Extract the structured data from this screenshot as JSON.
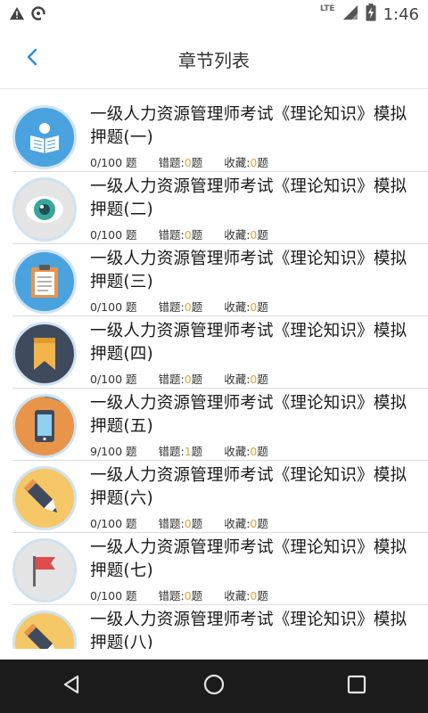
{
  "status_bar": {
    "time": "1:46",
    "network_label": "LTE",
    "icons": [
      "warning-icon",
      "data-saver-icon",
      "signal-icon",
      "battery-icon"
    ]
  },
  "header": {
    "title": "章节列表",
    "back_icon": "chevron-left-icon"
  },
  "labels": {
    "wrong_prefix": "错题:",
    "fav_prefix": "收藏:",
    "fav_suffix": "题",
    "wrong_suffix": "题"
  },
  "chapters": [
    {
      "title": "一级人力资源管理师考试《理论知识》模拟押题(一)",
      "progress": "0/100 题",
      "wrong": "0",
      "favorites": "0",
      "icon": "reading-person-icon"
    },
    {
      "title": "一级人力资源管理师考试《理论知识》模拟押题(二)",
      "progress": "0/100 题",
      "wrong": "0",
      "favorites": "0",
      "icon": "eye-icon"
    },
    {
      "title": "一级人力资源管理师考试《理论知识》模拟押题(三)",
      "progress": "0/100 题",
      "wrong": "0",
      "favorites": "0",
      "icon": "clipboard-icon"
    },
    {
      "title": "一级人力资源管理师考试《理论知识》模拟押题(四)",
      "progress": "0/100 题",
      "wrong": "0",
      "favorites": "0",
      "icon": "bookmark-icon"
    },
    {
      "title": "一级人力资源管理师考试《理论知识》模拟押题(五)",
      "progress": "9/100 题",
      "wrong": "1",
      "favorites": "0",
      "icon": "tablet-icon",
      "progress_fraction": 0.09
    },
    {
      "title": "一级人力资源管理师考试《理论知识》模拟押题(六)",
      "progress": "0/100 题",
      "wrong": "0",
      "favorites": "0",
      "icon": "pencil-icon"
    },
    {
      "title": "一级人力资源管理师考试《理论知识》模拟押题(七)",
      "progress": "0/100 题",
      "wrong": "0",
      "favorites": "0",
      "icon": "flag-icon"
    },
    {
      "title": "一级人力资源管理师考试《理论知识》模拟押题(八)",
      "progress": "",
      "wrong": "",
      "favorites": "",
      "icon": "pencil-icon"
    }
  ],
  "colors": {
    "accent": "#2b8fd9",
    "count_highlight": "#e6a33a",
    "nav_bar": "#1b1b1b",
    "icon_ring": "#cfe3f1"
  },
  "nav": {
    "back_icon": "triangle-back-icon",
    "home_icon": "circle-home-icon",
    "recents_icon": "square-recents-icon"
  }
}
